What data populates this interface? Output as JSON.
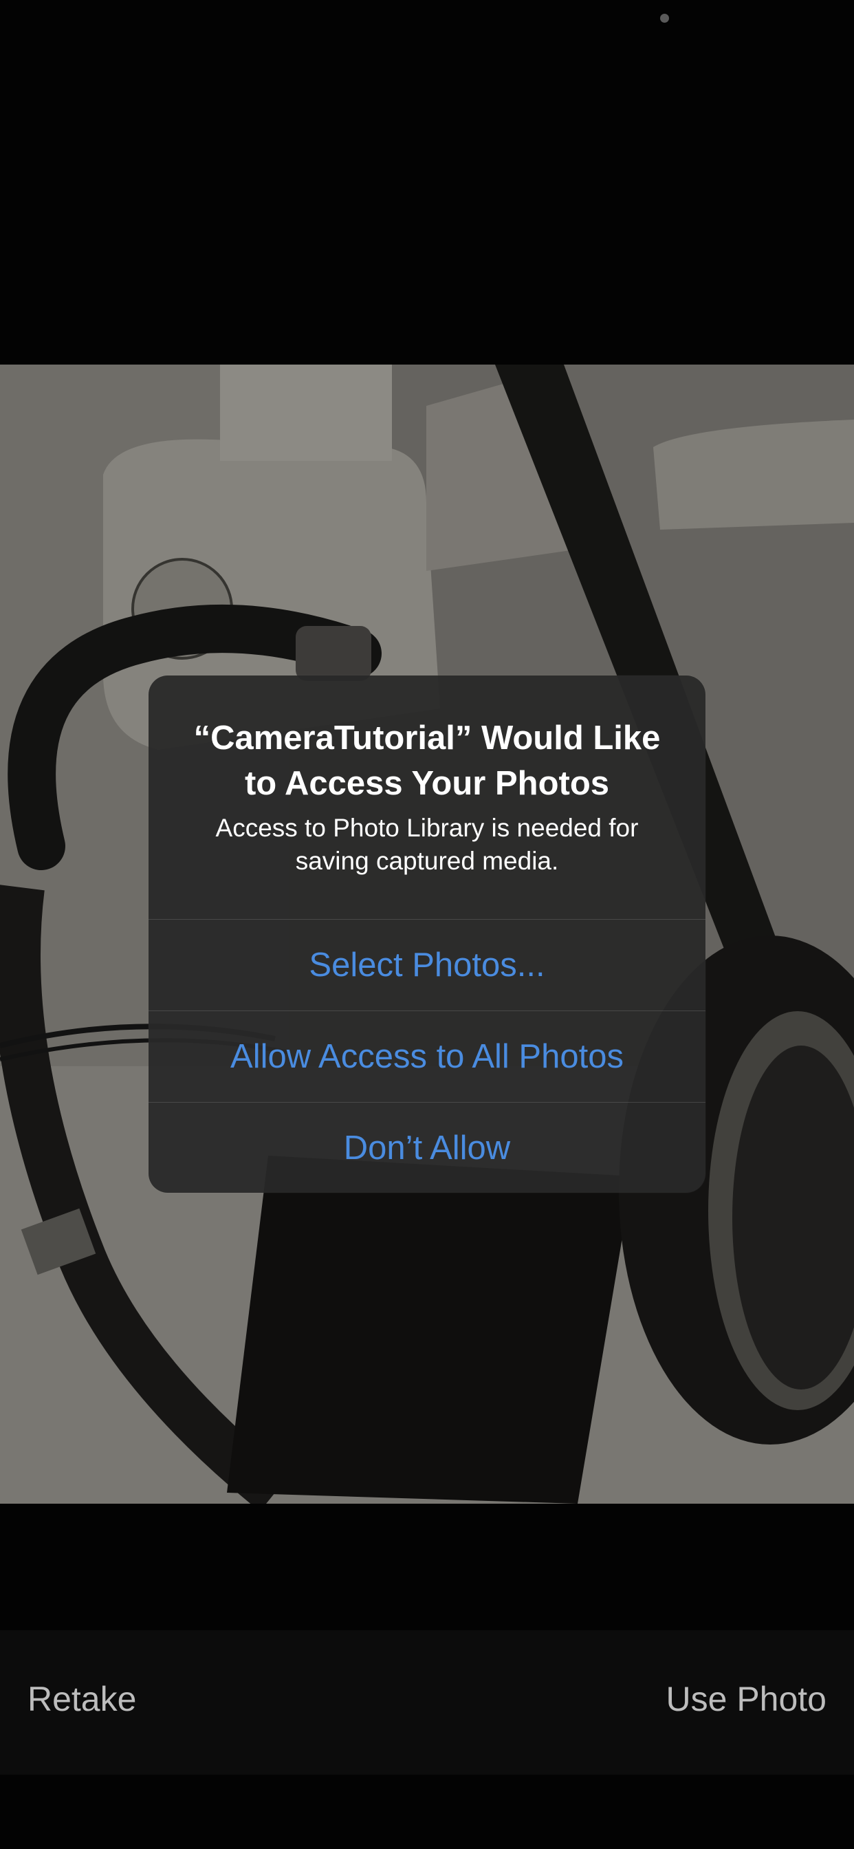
{
  "alert": {
    "title": "“CameraTutorial” Would Like to Access Your Photos",
    "message": "Access to Photo Library is needed for saving captured media.",
    "buttons": [
      {
        "label": "Select Photos..."
      },
      {
        "label": "Allow Access to All Photos"
      },
      {
        "label": "Don’t Allow"
      }
    ]
  },
  "bottom_bar": {
    "retake_label": "Retake",
    "use_photo_label": "Use Photo"
  },
  "colors": {
    "background": "#030303",
    "alert_background": "#282828",
    "alert_button_text": "#4a8ce0",
    "bottom_bar_text": "#bdbdbd"
  }
}
